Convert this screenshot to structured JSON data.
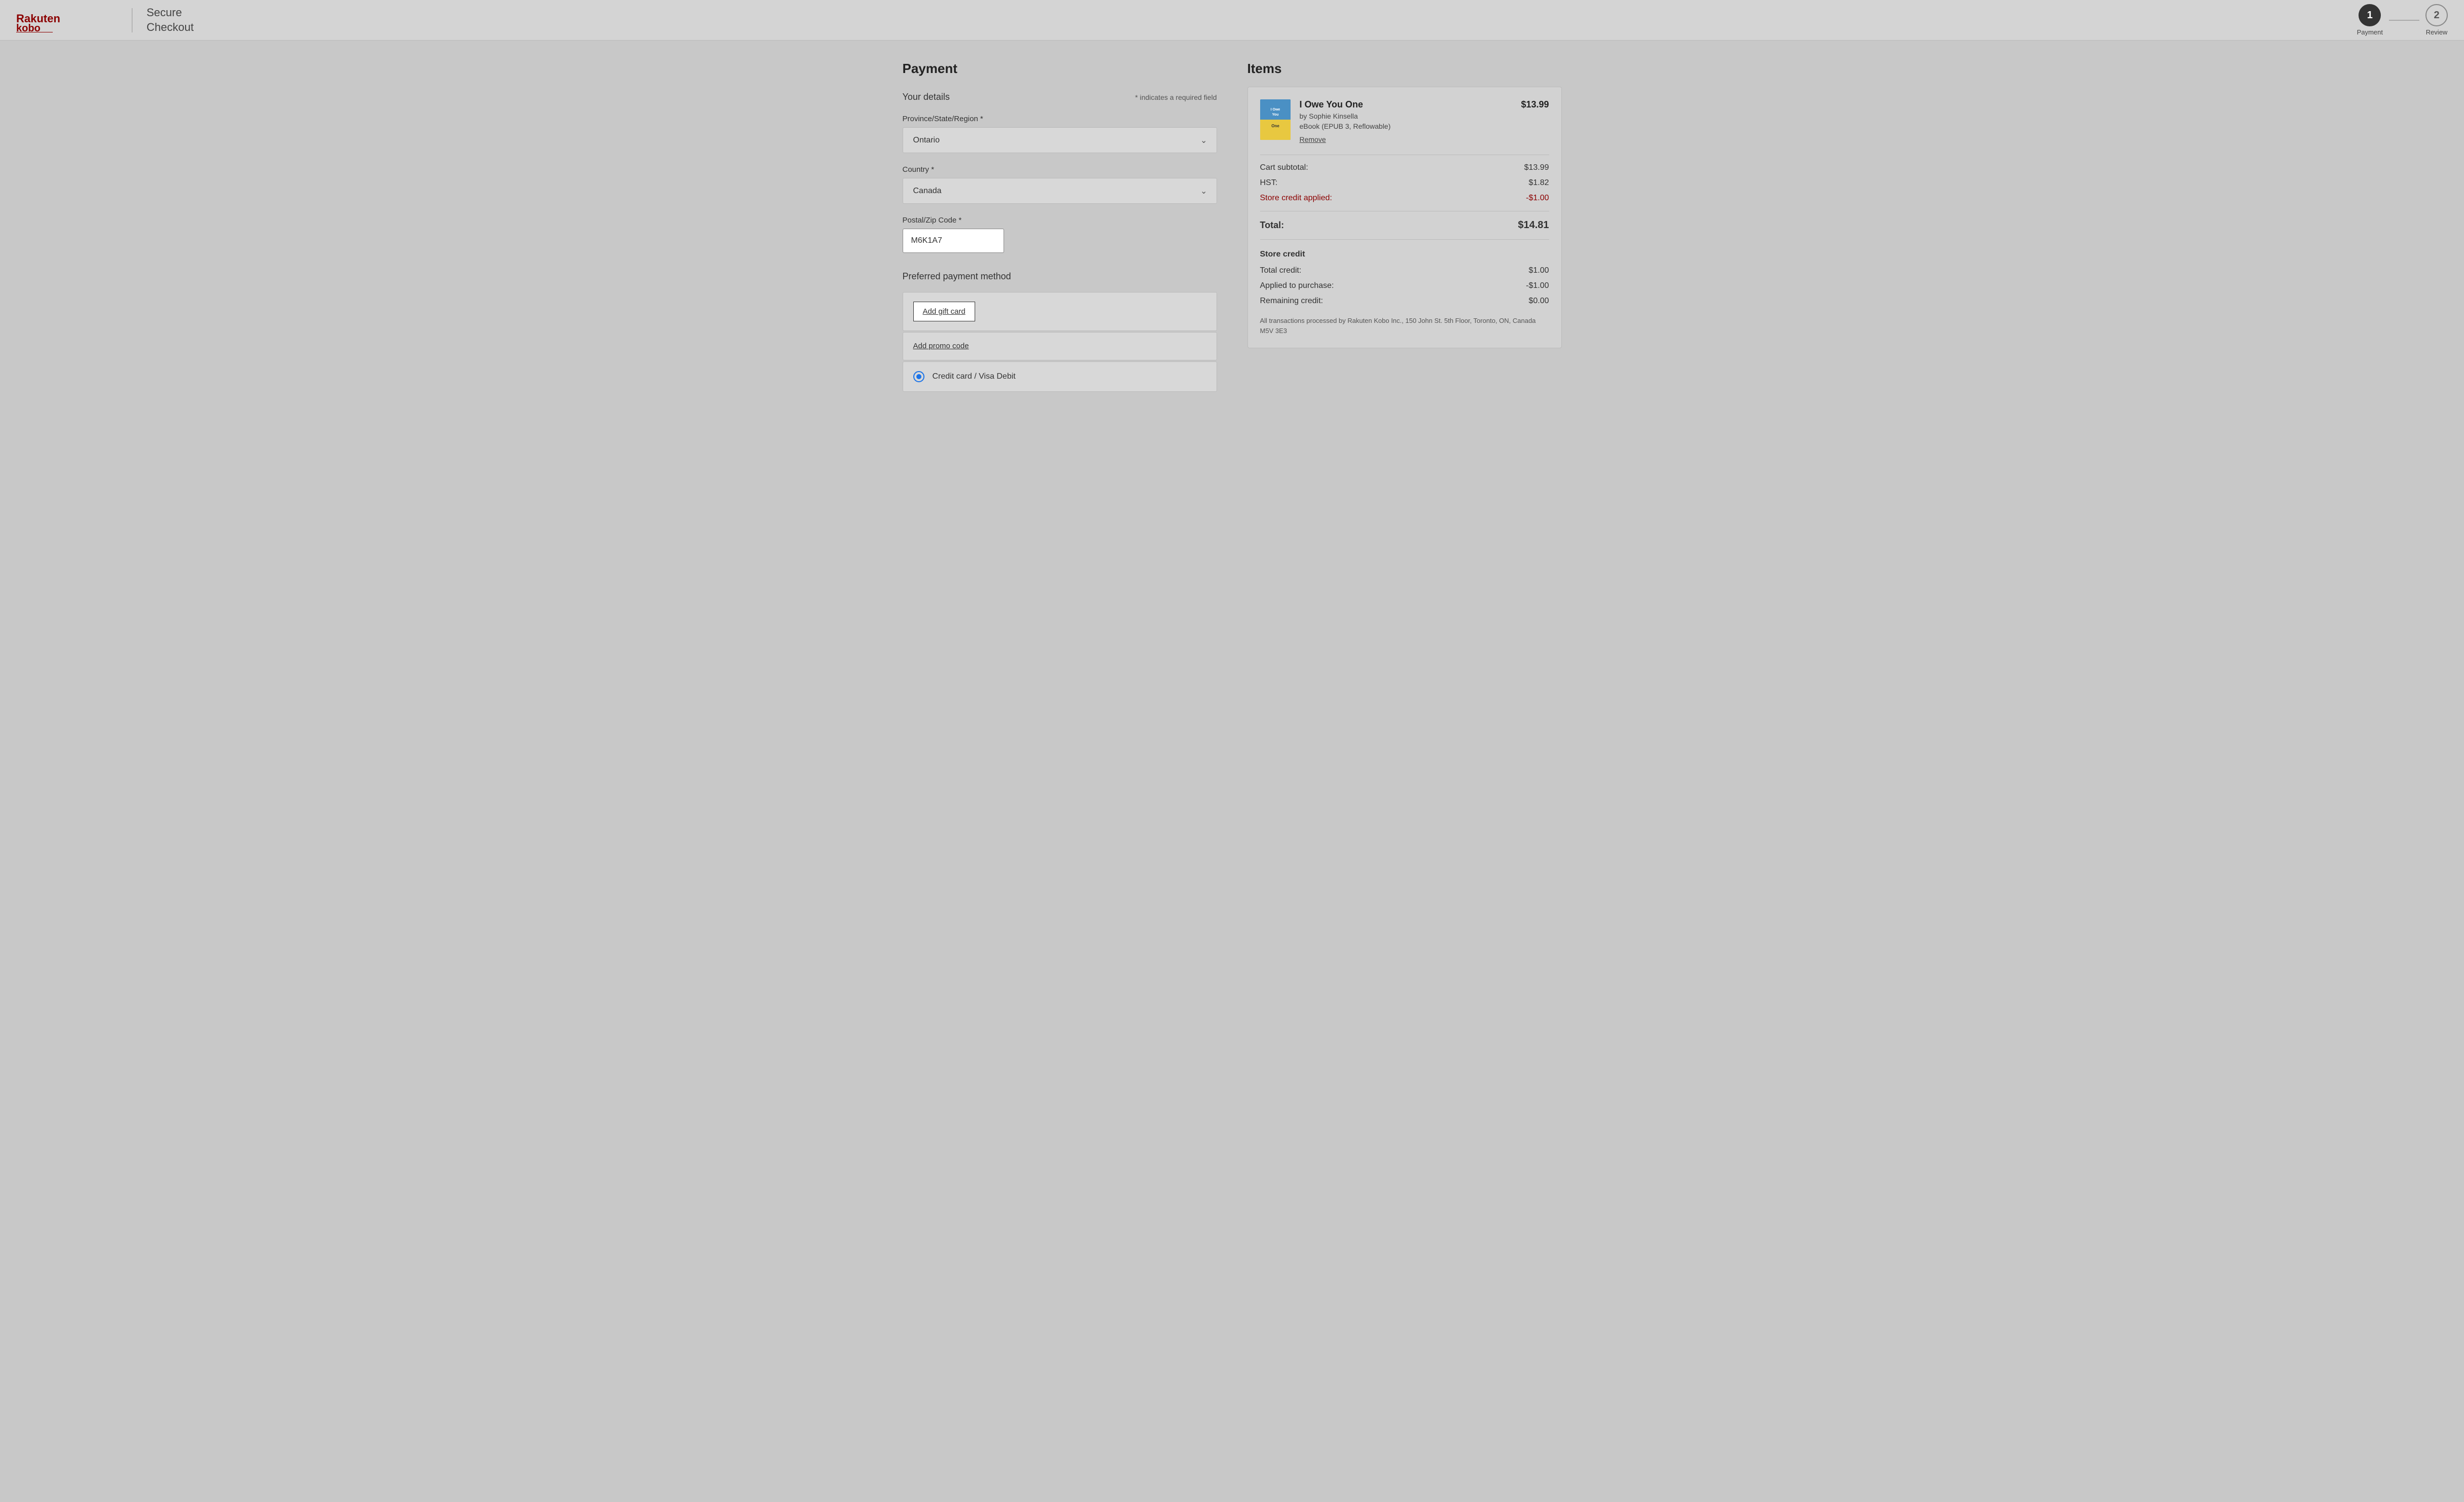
{
  "header": {
    "logo": {
      "rakuten": "Rakuten",
      "kobo": "kobo"
    },
    "secure_checkout": "Secure\nCheckout",
    "secure_checkout_line1": "Secure",
    "secure_checkout_line2": "Checkout",
    "steps": [
      {
        "number": "1",
        "label": "Payment",
        "active": true
      },
      {
        "number": "2",
        "label": "Review",
        "active": false
      }
    ]
  },
  "left": {
    "section_title": "Payment",
    "your_details_label": "Your details",
    "required_note": "* indicates a required field",
    "province_label": "Province/State/Region *",
    "province_value": "Ontario",
    "country_label": "Country *",
    "country_value": "Canada",
    "postal_label": "Postal/Zip Code *",
    "postal_value": "M6K1A7",
    "payment_method_title": "Preferred payment method",
    "add_gift_card": "Add gift card",
    "add_promo_code": "Add promo code",
    "credit_card_label": "Credit card / Visa Debit"
  },
  "right": {
    "items_title": "Items",
    "book": {
      "title": "I Owe You One",
      "author": "by Sophie Kinsella",
      "format": "eBook (EPUB 3, Reflowable)",
      "price": "$13.99",
      "remove_label": "Remove"
    },
    "cart_subtotal_label": "Cart subtotal:",
    "cart_subtotal_value": "$13.99",
    "hst_label": "HST:",
    "hst_value": "$1.82",
    "store_credit_applied_label": "Store credit applied:",
    "store_credit_applied_value": "-$1.00",
    "total_label": "Total:",
    "total_value": "$14.81",
    "store_credit_section_title": "Store credit",
    "total_credit_label": "Total credit:",
    "total_credit_value": "$1.00",
    "applied_to_purchase_label": "Applied to purchase:",
    "applied_to_purchase_value": "-$1.00",
    "remaining_credit_label": "Remaining credit:",
    "remaining_credit_value": "$0.00",
    "transaction_note": "All transactions processed by Rakuten Kobo Inc., 150 John St. 5th Floor, Toronto, ON, Canada M5V 3E3"
  }
}
